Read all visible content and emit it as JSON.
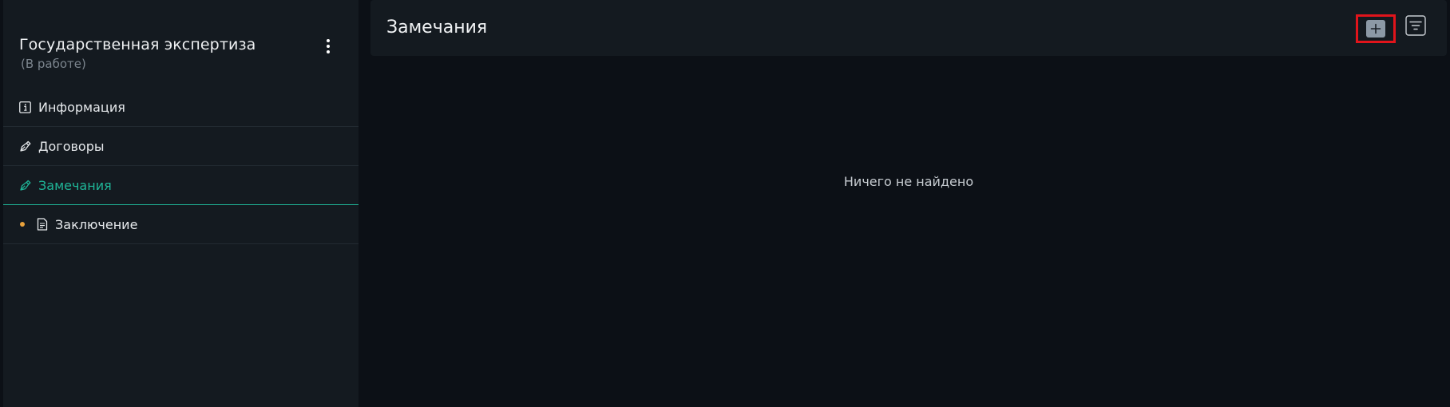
{
  "project": {
    "title": "Государственная экспертиза",
    "status": "(В работе)"
  },
  "sidebar": {
    "items": [
      {
        "label": "Информация",
        "icon": "info-icon",
        "active": false
      },
      {
        "label": "Договоры",
        "icon": "pen-icon",
        "active": false
      },
      {
        "label": "Замечания",
        "icon": "pen-icon",
        "active": true
      },
      {
        "label": "Заключение",
        "icon": "document-icon",
        "active": false,
        "dot": true
      }
    ]
  },
  "header": {
    "title": "Замечания"
  },
  "main": {
    "empty_message": "Ничего не найдено"
  },
  "colors": {
    "accent": "#1fb597",
    "warning_dot": "#e8a13b",
    "highlight_border": "#e1141b",
    "panel": "#141a20",
    "background": "#0c1016"
  }
}
